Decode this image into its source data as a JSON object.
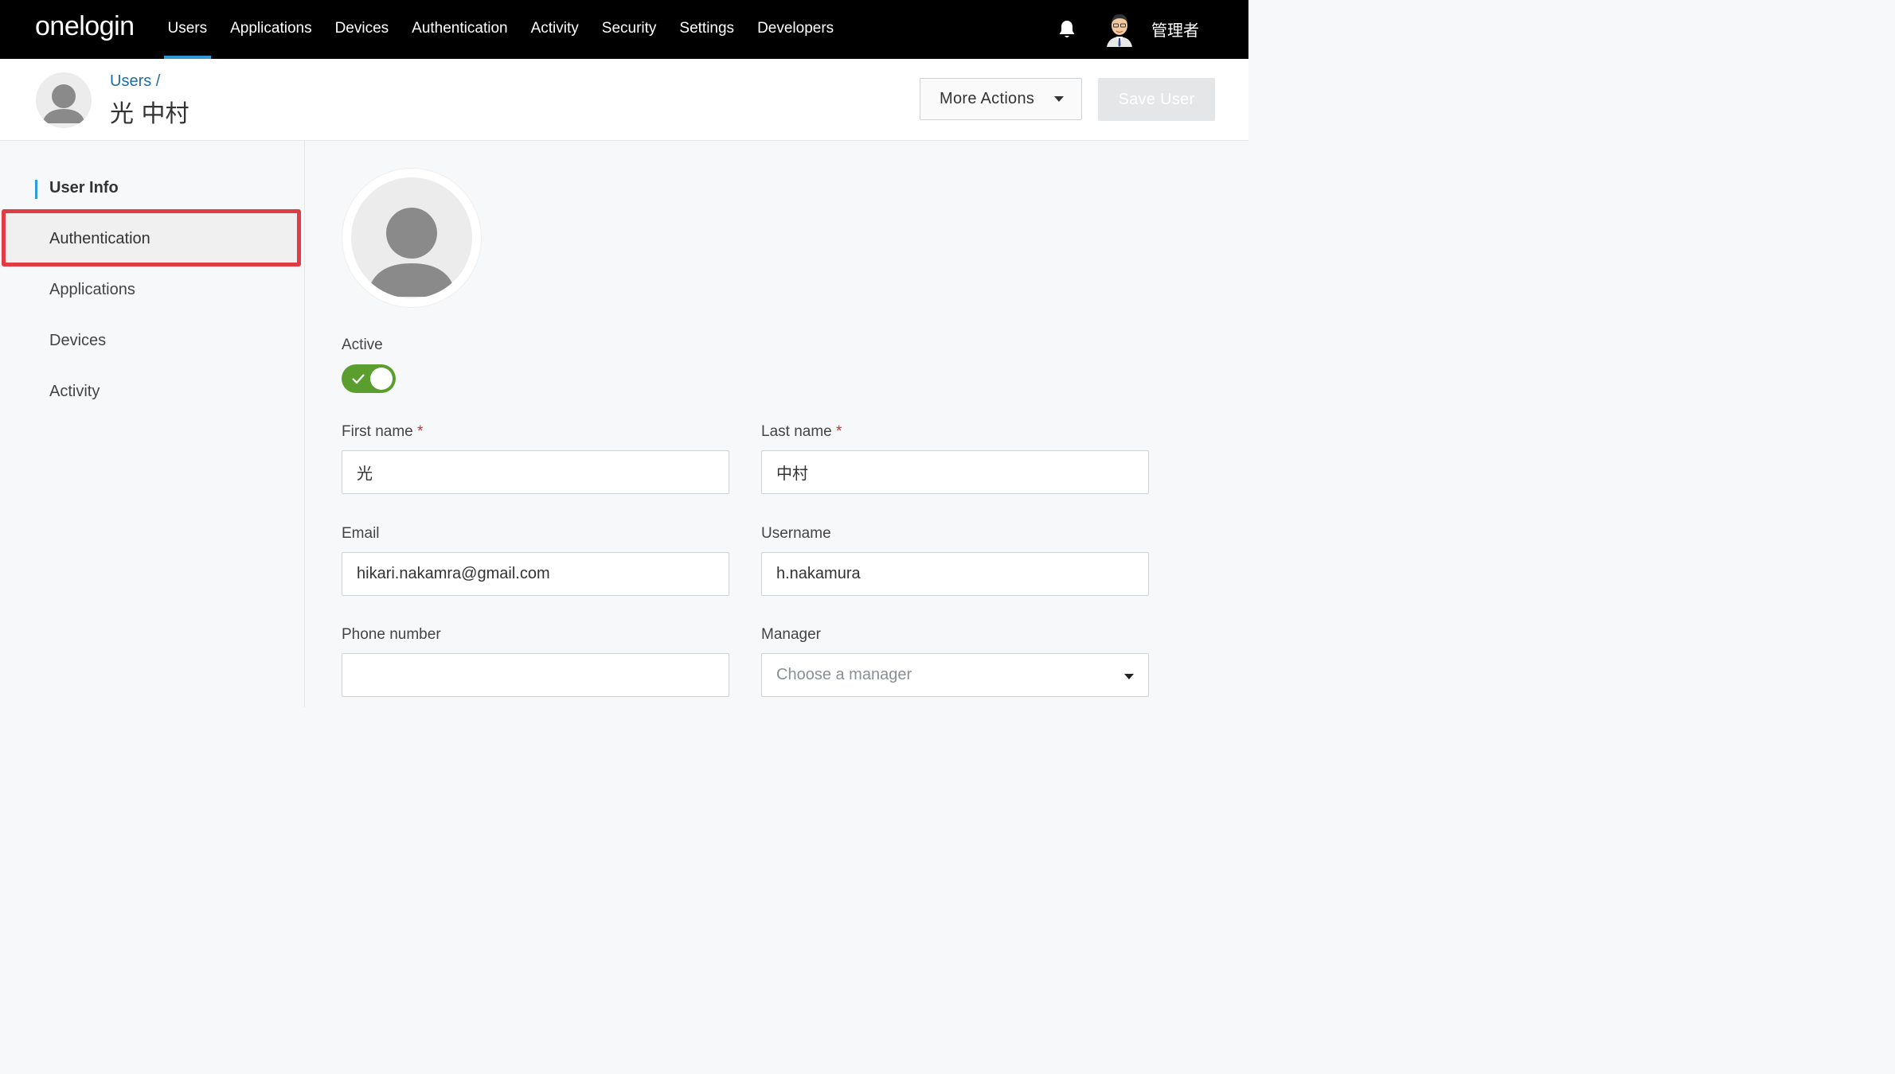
{
  "app": {
    "logo_text": "onelogin"
  },
  "nav": {
    "items": [
      {
        "label": "Users",
        "active": true
      },
      {
        "label": "Applications"
      },
      {
        "label": "Devices"
      },
      {
        "label": "Authentication"
      },
      {
        "label": "Activity"
      },
      {
        "label": "Security"
      },
      {
        "label": "Settings"
      },
      {
        "label": "Developers"
      }
    ],
    "notifications_icon": "bell-icon",
    "admin_name": "管理者"
  },
  "header": {
    "breadcrumb": "Users /",
    "user_name": "光 中村",
    "more_actions_label": "More Actions",
    "save_label": "Save User"
  },
  "sidebar": {
    "items": [
      {
        "label": "User Info",
        "active": true
      },
      {
        "label": "Authentication",
        "highlighted": true
      },
      {
        "label": "Applications"
      },
      {
        "label": "Devices"
      },
      {
        "label": "Activity"
      }
    ]
  },
  "form": {
    "active_label": "Active",
    "active_value": true,
    "first_name_label": "First name",
    "first_name_value": "光",
    "last_name_label": "Last name",
    "last_name_value": "中村",
    "required_mark": "*",
    "email_label": "Email",
    "email_value": "hikari.nakamra@gmail.com",
    "username_label": "Username",
    "username_value": "h.nakamura",
    "phone_label": "Phone number",
    "phone_value": "",
    "manager_label": "Manager",
    "manager_placeholder": "Choose a manager"
  },
  "colors": {
    "accent": "#2e9bd6",
    "toggle_on": "#5a9e2f",
    "highlight": "#e03c45",
    "link": "#1b6fa6"
  }
}
